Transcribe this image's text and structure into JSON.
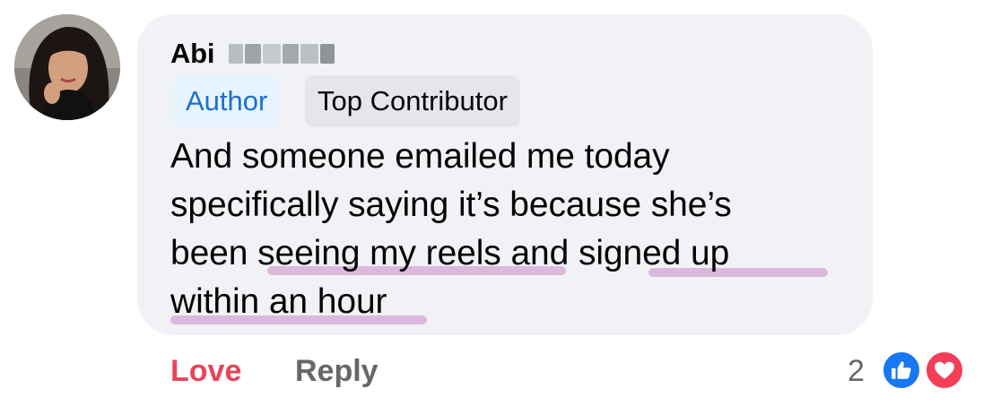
{
  "comment": {
    "author_name": "Abi",
    "badges": {
      "author": "Author",
      "top_contributor": "Top Contributor"
    },
    "text_lines": [
      "And someone emailed me today",
      "specifically saying it’s because she’s",
      "been seeing my reels and signed up",
      "within an hour"
    ],
    "highlight_color": "#dbb8dc"
  },
  "actions": {
    "love_label": "Love",
    "reply_label": "Reply"
  },
  "reactions": {
    "count": "2",
    "icons": [
      "like-icon",
      "heart-icon"
    ],
    "colors": {
      "like": "#1877f2",
      "heart": "#f33e58",
      "love_text": "#e8445a"
    }
  }
}
